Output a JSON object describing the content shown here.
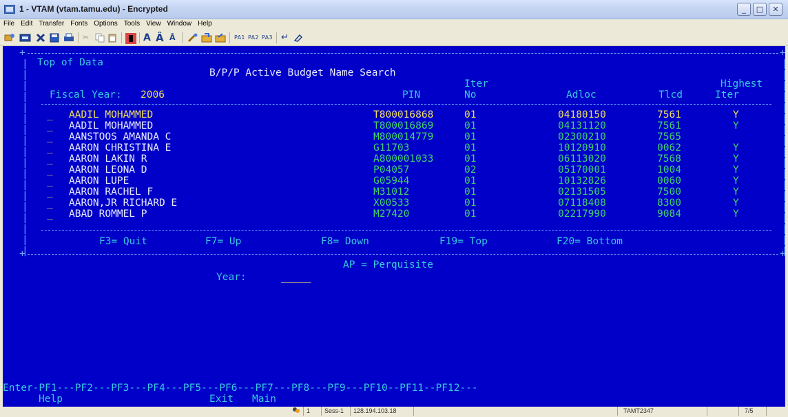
{
  "window": {
    "title": "1 - VTAM (vtam.tamu.edu) - Encrypted",
    "buttons": {
      "minimize": "_",
      "maximize": "□",
      "close": "✕"
    }
  },
  "menu": [
    "File",
    "Edit",
    "Transfer",
    "Fonts",
    "Options",
    "Tools",
    "View",
    "Window",
    "Help"
  ],
  "toolbar": {
    "pa1": "PA1",
    "pa2": "PA2",
    "pa3": "PA3",
    "enter_glyph": "↵"
  },
  "terminal": {
    "top_of_data": "Top of Data",
    "screen_title": "B/P/P Active Budget Name Search",
    "fiscal_label": "Fiscal Year:",
    "fiscal_year": "2006",
    "headers": {
      "iter_top": "Iter",
      "highest_top": "Highest",
      "pin": "PIN",
      "no": "No",
      "adloc": "Adloc",
      "tlcd": "Tlcd",
      "iter": "Iter"
    },
    "rows": [
      {
        "name": "AADIL MOHAMMED",
        "pin": "T800016868",
        "no": "01",
        "adloc": "04180150",
        "tlcd": "7561",
        "highest": "Y",
        "highlight": true
      },
      {
        "name": "AADIL MOHAMMED",
        "pin": "T800016869",
        "no": "01",
        "adloc": "04131120",
        "tlcd": "7561",
        "highest": "Y",
        "highlight": false
      },
      {
        "name": "AANSTOOS AMANDA C",
        "pin": "M800014779",
        "no": "01",
        "adloc": "02300210",
        "tlcd": "7565",
        "highest": "",
        "highlight": false
      },
      {
        "name": "AARON CHRISTINA E",
        "pin": "G11703",
        "no": "01",
        "adloc": "10120910",
        "tlcd": "0062",
        "highest": "Y",
        "highlight": false
      },
      {
        "name": "AARON LAKIN R",
        "pin": "A800001033",
        "no": "01",
        "adloc": "06113020",
        "tlcd": "7568",
        "highest": "Y",
        "highlight": false
      },
      {
        "name": "AARON LEONA D",
        "pin": "P04057",
        "no": "02",
        "adloc": "05170001",
        "tlcd": "1004",
        "highest": "Y",
        "highlight": false
      },
      {
        "name": "AARON LUPE",
        "pin": "G05944",
        "no": "01",
        "adloc": "10132826",
        "tlcd": "0060",
        "highest": "Y",
        "highlight": false
      },
      {
        "name": "AARON RACHEL F",
        "pin": "M31012",
        "no": "01",
        "adloc": "02131505",
        "tlcd": "7500",
        "highest": "Y",
        "highlight": false
      },
      {
        "name": "AARON,JR RICHARD E",
        "pin": "X00533",
        "no": "01",
        "adloc": "07118408",
        "tlcd": "8300",
        "highest": "Y",
        "highlight": false
      },
      {
        "name": "ABAD ROMMEL P",
        "pin": "M27420",
        "no": "01",
        "adloc": "02217990",
        "tlcd": "9084",
        "highest": "Y",
        "highlight": false
      }
    ],
    "fkeys": [
      "F3= Quit",
      "F7= Up",
      "F8= Down",
      "F19= Top",
      "F20= Bottom"
    ],
    "ap_line": "AP = Perquisite",
    "year_label": "Year:",
    "year_value": "_____",
    "pf_line": "Enter-PF1---PF2---PF3---PF4---PF5---PF6---PF7---PF8---PF9---PF10--PF11--PF12---",
    "pf_labels": {
      "help": "Help",
      "exit": "Exit",
      "main": "Main"
    }
  },
  "statusbar": {
    "session_num": "1",
    "session": "Sess-1",
    "ip": "128.194.103.18",
    "terminal_id": "TAMT2347",
    "cursor": "7/5"
  },
  "colors": {
    "screen_bg": "#0000c8",
    "field": "#6fa8ff",
    "highlight": "#f0e060",
    "data": "#43d36c"
  }
}
